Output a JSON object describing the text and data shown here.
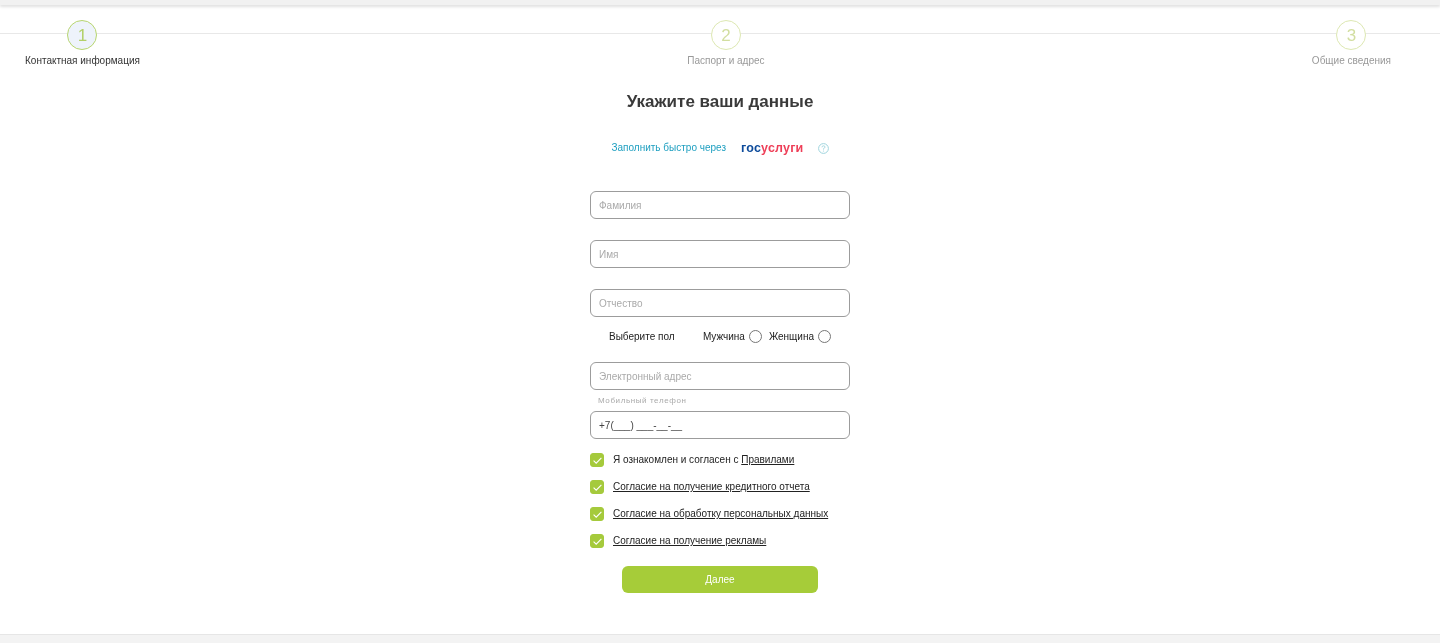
{
  "stepper": {
    "steps": [
      {
        "number": "1",
        "label": "Контактная информация",
        "selected": true
      },
      {
        "number": "2",
        "label": "Паспорт и адрес",
        "selected": false
      },
      {
        "number": "3",
        "label": "Общие сведения",
        "selected": false
      }
    ]
  },
  "form": {
    "title": "Укажите ваши данные",
    "gosuslugi": {
      "text": "Заполнить быстро через",
      "logo": [
        "гос",
        "услуги"
      ]
    },
    "fields": [
      {
        "placeholder": "Фамилия"
      },
      {
        "placeholder": "Имя"
      },
      {
        "placeholder": "Отчество"
      }
    ],
    "gender": {
      "label": "Выберите пол",
      "options": [
        {
          "label": "Мужчина",
          "selected": false
        },
        {
          "label": "Женщина",
          "selected": false
        }
      ]
    },
    "email": {
      "placeholder": "Электронный адрес"
    },
    "phone": {
      "label": "Мобильный телефон",
      "value": "+7(___) ___-__-__"
    },
    "consents": [
      {
        "text": "Я ознакомлен и согласен с",
        "link": "Правилами",
        "checked": true
      },
      {
        "link": "Согласие на получение кредитного отчета",
        "checked": true
      },
      {
        "link": "Согласие на обработку персональных данных",
        "checked": true
      },
      {
        "link": "Согласие на получение рекламы",
        "checked": true
      }
    ],
    "submit": "Далее"
  }
}
